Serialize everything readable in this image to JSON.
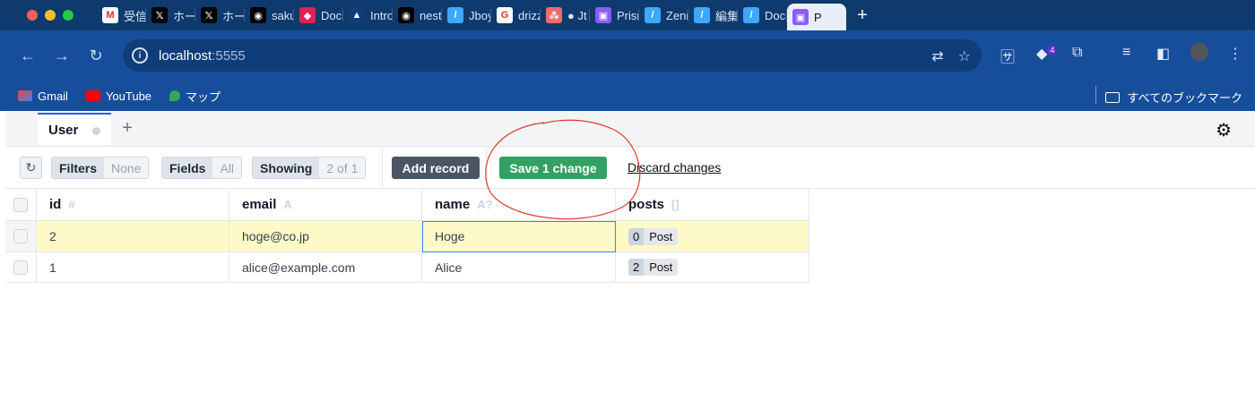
{
  "browser": {
    "tabs": [
      {
        "title": "受信",
        "icon": "gmail-icon",
        "color": "#ffffff",
        "glyph": "M"
      },
      {
        "title": "ホーム",
        "icon": "x-icon",
        "color": "#000000",
        "glyph": "𝕏"
      },
      {
        "title": "ホーム",
        "icon": "x-icon",
        "color": "#000000",
        "glyph": "𝕏"
      },
      {
        "title": "saku",
        "icon": "github-icon",
        "color": "#000000",
        "glyph": "◉"
      },
      {
        "title": "Docu",
        "icon": "nest-icon",
        "color": "#e0234e",
        "glyph": "◆"
      },
      {
        "title": "Intro",
        "icon": "prisma-icon",
        "color": "#0f3d7a",
        "glyph": "▲"
      },
      {
        "title": "nest",
        "icon": "github-icon",
        "color": "#000000",
        "glyph": "◉"
      },
      {
        "title": "Jboy",
        "icon": "zenn-icon",
        "color": "#3ea8ff",
        "glyph": "/"
      },
      {
        "title": "drizz",
        "icon": "google-icon",
        "color": "#ffffff",
        "glyph": "G"
      },
      {
        "title": "● Jt",
        "icon": "asana-icon",
        "color": "#f06a6a",
        "glyph": "⁂"
      },
      {
        "title": "Prisn",
        "icon": "prisma-studio-icon",
        "color": "#8b5cf6",
        "glyph": "▣"
      },
      {
        "title": "Zenn",
        "icon": "zenn-icon",
        "color": "#3ea8ff",
        "glyph": "/"
      },
      {
        "title": "編集",
        "icon": "zenn-icon",
        "color": "#3ea8ff",
        "glyph": "/"
      },
      {
        "title": "Docu",
        "icon": "zenn-icon",
        "color": "#3ea8ff",
        "glyph": "/"
      },
      {
        "title": "P",
        "icon": "prisma-studio-icon",
        "color": "#8b5cf6",
        "glyph": "▣",
        "active": true
      }
    ],
    "new_tab_label": "+",
    "url_host": "localhost",
    "url_port": ":5555",
    "extension_badge": "4",
    "bookmarks": [
      {
        "label": "Gmail",
        "icon": "gmail-icon"
      },
      {
        "label": "YouTube",
        "icon": "youtube-icon"
      },
      {
        "label": "マップ",
        "icon": "maps-icon"
      }
    ],
    "all_bookmarks_label": "すべてのブックマーク"
  },
  "app": {
    "model_tab": "User",
    "add_tab": "+",
    "toolbar": {
      "filters_label": "Filters",
      "filters_value": "None",
      "fields_label": "Fields",
      "fields_value": "All",
      "showing_label": "Showing",
      "showing_value": "2 of 1",
      "add_record": "Add record",
      "save_changes": "Save 1 change",
      "discard_changes": "Discard changes"
    },
    "columns": [
      {
        "name": "id",
        "type": "#"
      },
      {
        "name": "email",
        "type": "A"
      },
      {
        "name": "name",
        "type": "A?"
      },
      {
        "name": "posts",
        "type": "[]"
      }
    ],
    "rows": [
      {
        "id": "2",
        "email": "hoge@co.jp",
        "name": "Hoge",
        "posts_count": "0",
        "posts_label": "Post",
        "edited": true
      },
      {
        "id": "1",
        "email": "alice@example.com",
        "name": "Alice",
        "posts_count": "2",
        "posts_label": "Post",
        "edited": false
      }
    ]
  },
  "colors": {
    "chrome_dark": "#0e3a6d",
    "chrome": "#174e9c",
    "save_green": "#34a063",
    "edited_row": "#fefac8",
    "annotation_red": "#e03a2f"
  }
}
